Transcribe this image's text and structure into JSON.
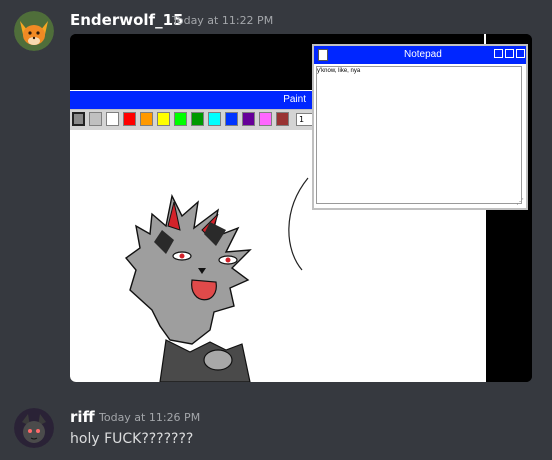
{
  "messages": [
    {
      "username": "Enderwolf_15",
      "timestamp": "Today at 11:22 PM",
      "avatar": "fox-avatar"
    },
    {
      "username": "riff",
      "timestamp": "Today at 11:26 PM",
      "text": "holy FUCK???????",
      "avatar": "dark-cat-avatar"
    }
  ],
  "attachment": {
    "paint": {
      "title": "Paint",
      "brush_size": "1",
      "palette": [
        "#c0c0c0",
        "#ffffff",
        "#ff0000",
        "#ff9900",
        "#ffff00",
        "#00ff00",
        "#009900",
        "#00ffff",
        "#0033ff",
        "#660099",
        "#ff66ff",
        "#993333"
      ]
    },
    "notepad": {
      "title": "Notepad",
      "content": "y'know, like, nya"
    }
  },
  "colors": {
    "background": "#36393f",
    "titlebar_blue": "#0026ff",
    "username": "#ffffff",
    "timestamp": "#a3a6aa"
  }
}
